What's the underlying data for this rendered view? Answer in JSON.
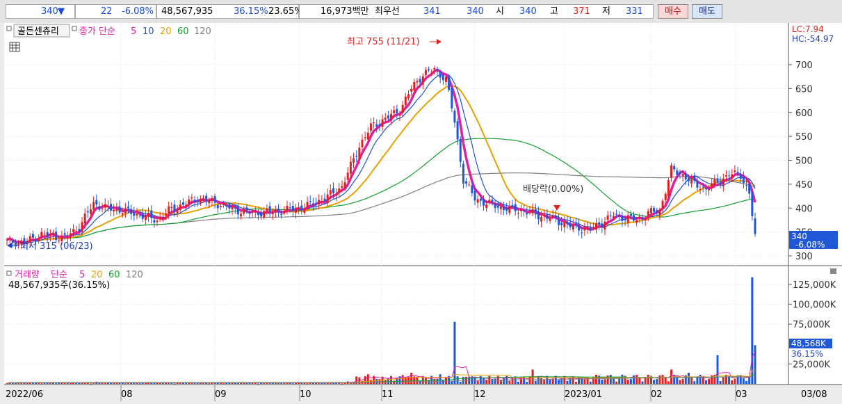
{
  "quote": {
    "price": "340",
    "direction_arrow": "▼",
    "change": "22",
    "change_pct": "-6.08%",
    "volume": "48,567,935",
    "volume_ratio": "36.15%",
    "turnover": "23.65%",
    "amount": "16,973백만",
    "best_label": "최우선",
    "best_ask": "341",
    "best_bid": "340",
    "open_label": "시",
    "open": "340",
    "high_label": "고",
    "high": "371",
    "low_label": "저",
    "low": "331"
  },
  "buttons": {
    "buy": "매수",
    "sell": "매도"
  },
  "price_panel": {
    "indicator_button": "골든센츄리",
    "ma_label": "종가 단순",
    "ma_periods": [
      "5",
      "10",
      "20",
      "60",
      "120"
    ],
    "ma_colors": [
      "#e020a0",
      "#2050d0",
      "#e8a000",
      "#10a030",
      "#808080"
    ],
    "lc": "LC:7.94",
    "hc": "HC:-54.97",
    "high_marker": "최고 755 (11/21)",
    "low_marker": "최저 315 (06/23)",
    "dividend_label": "배당락(0.00%)",
    "current_price": "340",
    "current_pct": "-6.08%"
  },
  "volume_panel": {
    "label": "거래량",
    "ma_label": "단순",
    "ma_periods": [
      "5",
      "20",
      "60",
      "120"
    ],
    "ma_colors": [
      "#e020a0",
      "#e8a000",
      "#10a030",
      "#808080"
    ],
    "summary": "48,567,935주(36.15%)",
    "current_volume": "48,568K",
    "current_pct": "36.15%"
  },
  "x_axis_labels": [
    "2022/06",
    "08",
    "09",
    "10",
    "11",
    "12",
    "2023/01",
    "02",
    "03"
  ],
  "x_axis_right": "03/08",
  "chart_data": [
    {
      "type": "candlestick",
      "y_ticks": [
        300,
        350,
        400,
        450,
        500,
        550,
        600,
        650,
        700
      ],
      "ylim": [
        285,
        760
      ],
      "x_months": [
        "2022/06",
        "08",
        "09",
        "10",
        "11",
        "12",
        "2023/01",
        "02",
        "03"
      ],
      "series_anchors_close": [
        [
          0,
          330
        ],
        [
          6,
          328
        ],
        [
          12,
          345
        ],
        [
          20,
          338
        ],
        [
          25,
          360
        ],
        [
          30,
          410
        ],
        [
          34,
          400
        ],
        [
          40,
          395
        ],
        [
          48,
          382
        ],
        [
          52,
          375
        ],
        [
          56,
          395
        ],
        [
          62,
          410
        ],
        [
          66,
          420
        ],
        [
          72,
          412
        ],
        [
          78,
          398
        ],
        [
          84,
          390
        ],
        [
          92,
          392
        ],
        [
          100,
          398
        ],
        [
          104,
          405
        ],
        [
          110,
          420
        ],
        [
          116,
          445
        ],
        [
          122,
          530
        ],
        [
          126,
          570
        ],
        [
          132,
          590
        ],
        [
          136,
          605
        ],
        [
          140,
          650
        ],
        [
          144,
          680
        ],
        [
          148,
          690
        ],
        [
          152,
          670
        ],
        [
          155,
          580
        ],
        [
          158,
          460
        ],
        [
          162,
          420
        ],
        [
          166,
          410
        ],
        [
          172,
          400
        ],
        [
          178,
          395
        ],
        [
          184,
          385
        ],
        [
          190,
          375
        ],
        [
          196,
          360
        ],
        [
          202,
          355
        ],
        [
          206,
          370
        ],
        [
          210,
          385
        ],
        [
          214,
          380
        ],
        [
          218,
          375
        ],
        [
          222,
          390
        ],
        [
          226,
          395
        ],
        [
          230,
          480
        ],
        [
          234,
          470
        ],
        [
          238,
          450
        ],
        [
          242,
          440
        ],
        [
          246,
          455
        ],
        [
          250,
          470
        ],
        [
          254,
          470
        ],
        [
          257,
          430
        ],
        [
          259,
          340
        ]
      ],
      "high_point": {
        "date": "11/21",
        "value": 755
      },
      "low_point": {
        "date": "06/23",
        "value": 315
      }
    },
    {
      "type": "bar",
      "y_ticks_labels": [
        "25,000K",
        "75,000K",
        "100,000K",
        "125,000K"
      ],
      "y_ticks": [
        25000,
        75000,
        100000,
        125000
      ],
      "ylim": [
        0,
        135000
      ],
      "spikes_k": [
        [
          0,
          800
        ],
        [
          31,
          2500
        ],
        [
          62,
          1200
        ],
        [
          118,
          3000
        ],
        [
          125,
          12000
        ],
        [
          130,
          9000
        ],
        [
          137,
          11000
        ],
        [
          140,
          14000
        ],
        [
          150,
          12000
        ],
        [
          155,
          78000
        ],
        [
          160,
          9000
        ],
        [
          182,
          18000
        ],
        [
          200,
          6000
        ],
        [
          230,
          18000
        ],
        [
          236,
          14000
        ],
        [
          246,
          36000
        ],
        [
          255,
          7000
        ],
        [
          258,
          134000
        ],
        [
          259,
          48568
        ]
      ]
    }
  ]
}
